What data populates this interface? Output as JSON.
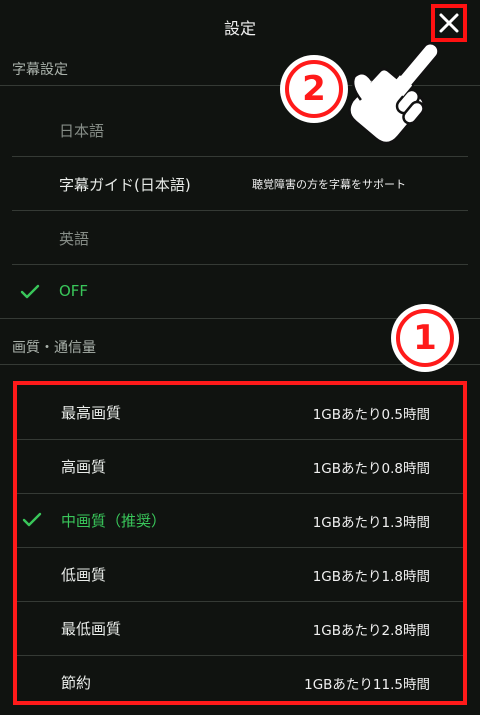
{
  "header": {
    "title": "設定"
  },
  "subtitle_section": {
    "heading": "字幕設定",
    "items": [
      {
        "label": "日本語",
        "state": "disabled"
      },
      {
        "label": "字幕ガイド(日本語)",
        "desc": "聴覚障害の方を字幕をサポート",
        "state": "normal"
      },
      {
        "label": "英語",
        "state": "disabled"
      },
      {
        "label": "OFF",
        "state": "selected"
      }
    ]
  },
  "quality_section": {
    "heading": "画質・通信量",
    "items": [
      {
        "label": "最高画質",
        "value": "1GBあたり0.5時間",
        "selected": false
      },
      {
        "label": "高画質",
        "value": "1GBあたり0.8時間",
        "selected": false
      },
      {
        "label": "中画質（推奨）",
        "value": "1GBあたり1.3時間",
        "selected": true
      },
      {
        "label": "低画質",
        "value": "1GBあたり1.8時間",
        "selected": false
      },
      {
        "label": "最低画質",
        "value": "1GBあたり2.8時間",
        "selected": false
      },
      {
        "label": "節約",
        "value": "1GBあたり11.5時間",
        "selected": false
      }
    ]
  },
  "annotations": {
    "badge_1": "1",
    "badge_2": "2"
  },
  "icons": {
    "close": "close-icon",
    "check": "check-icon",
    "hand": "pointing-hand-icon"
  },
  "colors": {
    "background": "#101310",
    "accent_green": "#39c65a",
    "highlight_red": "#ff1a1a",
    "disabled_text": "#868d87"
  }
}
